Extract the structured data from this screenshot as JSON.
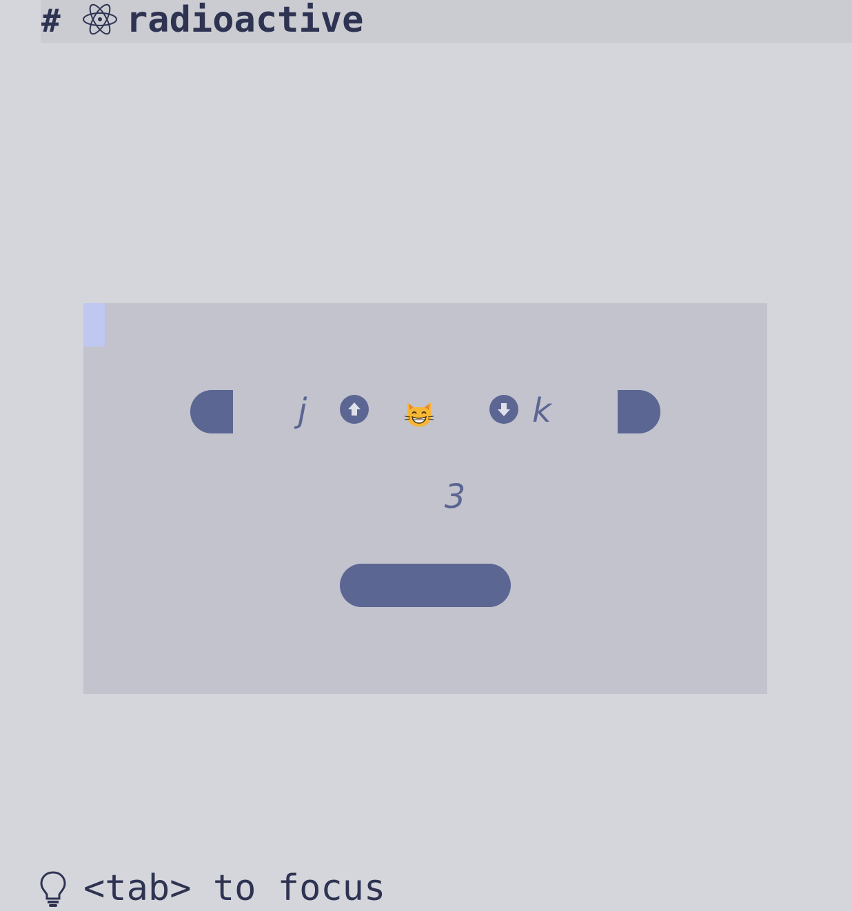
{
  "header": {
    "hash": "#",
    "atom_icon": "atom-icon",
    "title": "radioactive"
  },
  "panel": {
    "focus_marker_color": "#c0c7f0",
    "left_key": "j",
    "right_key": "k",
    "up_icon": "arrow-up-circle-icon",
    "down_icon": "arrow-down-circle-icon",
    "emoji_icon": "grinning-cat-emoji-icon",
    "counter": "3",
    "accent_color": "#5c6693"
  },
  "footer": {
    "hint_icon": "lightbulb-icon",
    "hint_text": "<tab> to focus"
  }
}
